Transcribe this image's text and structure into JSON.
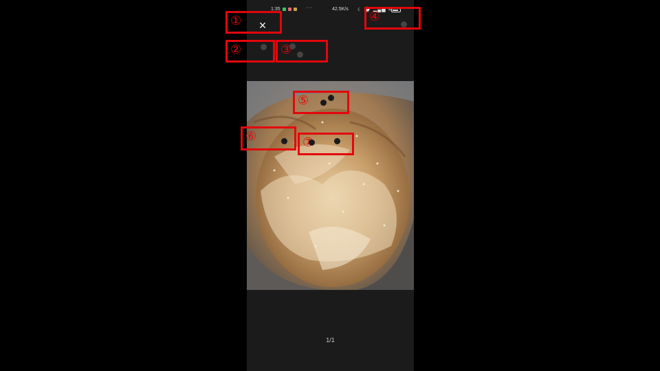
{
  "status_bar": {
    "time": "1:35",
    "more": "···",
    "net_speed": "42.5K/s",
    "icons": "☾ ⌚ ▂▄▆ ≋",
    "battery_level": 0.8
  },
  "viewer": {
    "close_icon": "×",
    "page_counter": "1/1"
  },
  "annotations": {
    "m1": "①",
    "m2": "②",
    "m3": "③",
    "m4": "④",
    "m5": "⑤",
    "m6": "⑥",
    "m7": "⑦"
  },
  "colors": {
    "marker": "#e4060c",
    "background": "#000000",
    "viewer_bg": "#1b1b1b"
  }
}
